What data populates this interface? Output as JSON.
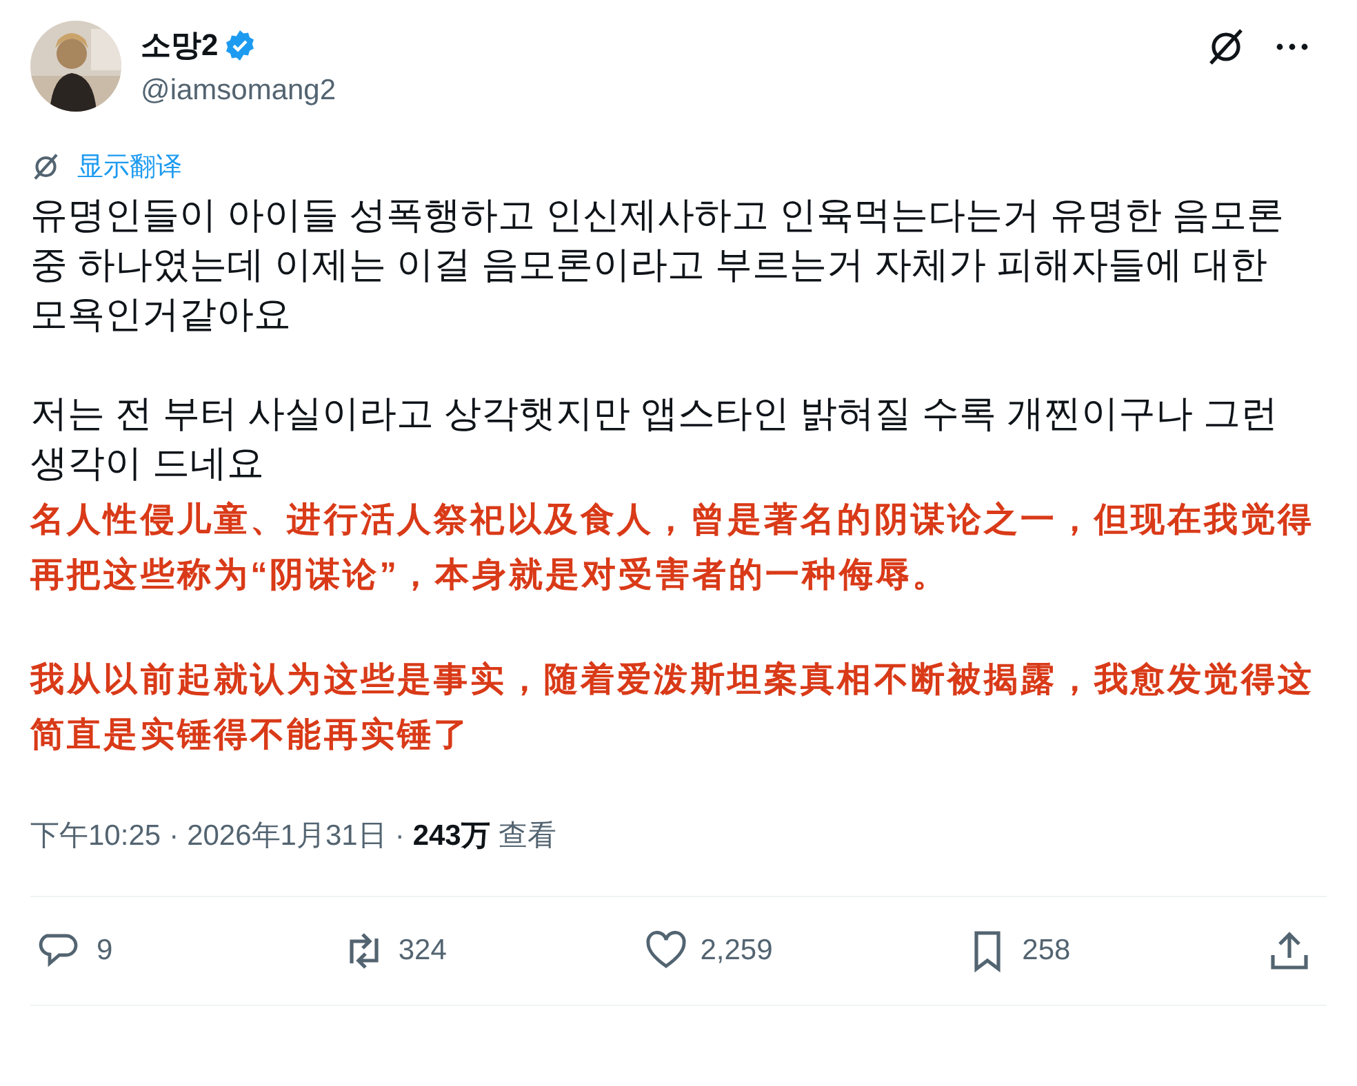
{
  "author": {
    "name": "소망2",
    "verified": true,
    "handle": "@iamsomang2"
  },
  "translate_link": "显示翻译",
  "paragraphs": [
    {
      "kind": "original",
      "text": "유명인들이 아이들 성폭행하고 인신제사하고 인육먹는다는거 유명한 음모론 중 하나였는데 이제는 이걸 음모론이라고 부르는거 자체가 피해자들에 대한 모욕인거같아요"
    },
    {
      "kind": "original",
      "text": "저는 전 부터 사실이라고 상각햇지만 앱스타인 밝혀질 수록 개찐이구나 그런 생각이 드네요"
    },
    {
      "kind": "translation",
      "text": "名人性侵儿童、进行活人祭祀以及食人，曾是著名的阴谋论之一，但现在我觉得再把这些称为“阴谋论”，本身就是对受害者的一种侮辱。"
    },
    {
      "kind": "translation",
      "text": "我从以前起就认为这些是事实，随着爱泼斯坦案真相不断被揭露，我愈发觉得这简直是实锤得不能再实锤了"
    }
  ],
  "meta": {
    "time": "下午10:25",
    "separator": "·",
    "date": "2026年1月31日",
    "separator_2": "·",
    "views_count": "243万",
    "views_label": "查看"
  },
  "actions": [
    {
      "kind": "reply",
      "count": "9"
    },
    {
      "kind": "retweet",
      "count": "324"
    },
    {
      "kind": "like",
      "count": "2,259"
    },
    {
      "kind": "bookmark",
      "count": "258"
    },
    {
      "kind": "share"
    }
  ]
}
